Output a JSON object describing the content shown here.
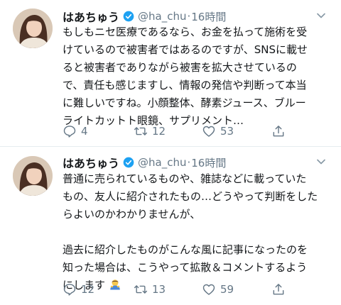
{
  "tweets": [
    {
      "name": "はあちゅう",
      "handle": "@ha_chu",
      "separator": "·",
      "time": "16時間",
      "lines": [
        "もしもニセ医療であるなら、お金を払って施術を受",
        "けているので被害者ではあるのですが、SNSに載せ",
        "ると被害者でありながら被害を拡大させているの",
        "で、責任も感じますし、情報の発信や判断って本当",
        "に難しいですね。小顔整体、酵素ジュース、ブルー",
        "ライトカットト眼鏡、サプリメント…"
      ],
      "replies": "4",
      "retweets": "12",
      "likes": "53"
    },
    {
      "name": "はあちゅう",
      "handle": "@ha_chu",
      "separator": "·",
      "time": "16時間",
      "lines": [
        "普通に売られているものや、雑誌などに載っていた",
        "もの、友人に紹介されたもの…どうやって判断をした",
        "らよいのかわかりませんが、",
        "",
        "過去に紹介したものがこんな風に記事になったのを",
        "知った場合は、こうやって拡散＆コメントするよう",
        "にします"
      ],
      "replies": "12",
      "retweets": "13",
      "likes": "59"
    }
  ],
  "icons": {
    "verified": "verified-badge-icon",
    "caret": "chevron-down-icon",
    "reply": "reply-icon",
    "retweet": "retweet-icon",
    "like": "heart-icon",
    "share": "share-icon",
    "emoji": "person-bowing-emoji"
  },
  "colors": {
    "text": "#14171a",
    "secondary": "#657786",
    "verified": "#1da1f2",
    "divider": "#e6ecf0"
  }
}
